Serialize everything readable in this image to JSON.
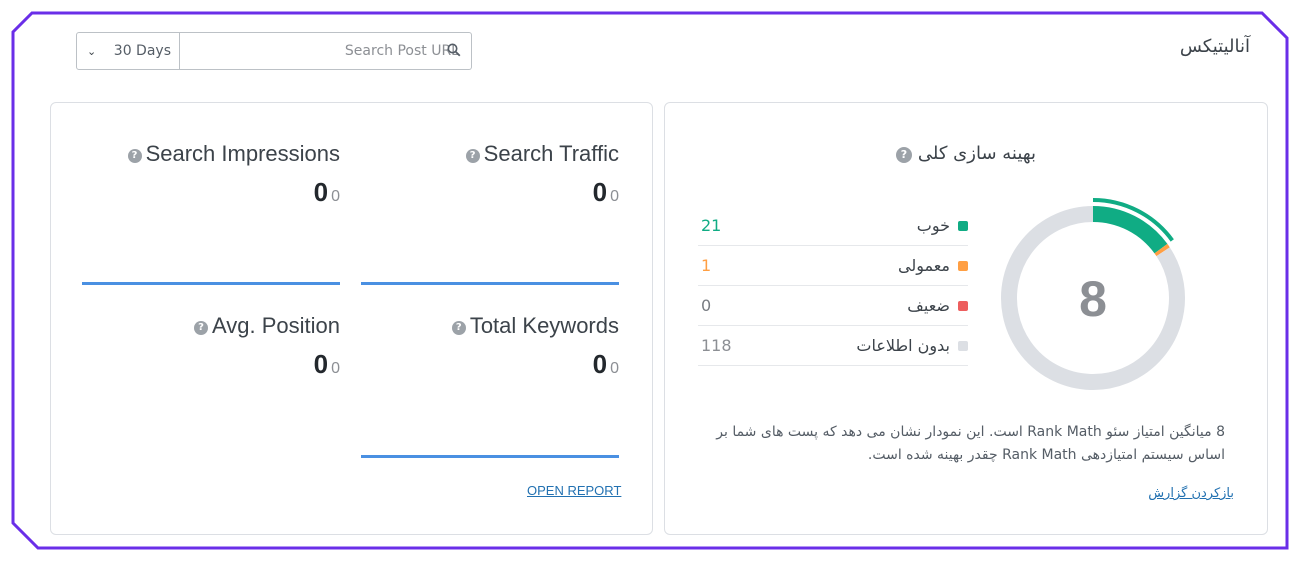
{
  "page_title": "آنالیتیکس",
  "toolbar": {
    "days_selected": "30 Days",
    "search_placeholder": "Search Post URL"
  },
  "metrics": {
    "search_traffic": {
      "label": "Search Traffic",
      "value": "0",
      "change": "0"
    },
    "search_impressions": {
      "label": "Search Impressions",
      "value": "0",
      "change": "0"
    },
    "total_keywords": {
      "label": "Total Keywords",
      "value": "0",
      "change": "0"
    },
    "avg_position": {
      "label": "Avg. Position",
      "value": "0",
      "change": "0"
    },
    "help_glyph": "?"
  },
  "open_report": "OPEN REPORT",
  "score": {
    "title": "بهینه سازی کلی",
    "value": "8",
    "legend": [
      {
        "label": "خوب",
        "count": "21",
        "color": "#10ac84"
      },
      {
        "label": "معمولی",
        "count": "1",
        "color": "#ff9f43"
      },
      {
        "label": "ضعیف",
        "count": "0",
        "color": "#ed5e5e"
      },
      {
        "label": "بدون اطلاعات",
        "count": "118",
        "color": "#dcdfe4"
      }
    ],
    "description": "8 میانگین امتیاز سئو Rank Math است. این نمودار نشان می دهد که پست های شما بر اساس سیستم امتیازدهی Rank Math چقدر بهینه شده است.",
    "refresh_link": "بازکردن گزارش"
  },
  "colors": {
    "frame": "#6a2ee8",
    "good": "#10ac84",
    "fair": "#ff9f43",
    "bad": "#ed5e5e",
    "none": "#dcdfe4",
    "sparkline": "#4a90e2",
    "link": "#2271b1"
  },
  "chart_data": {
    "type": "pie",
    "categories": [
      "خوب",
      "معمولی",
      "ضعیف",
      "بدون اطلاعات"
    ],
    "values": [
      21,
      1,
      0,
      118
    ],
    "center_label": "8"
  }
}
